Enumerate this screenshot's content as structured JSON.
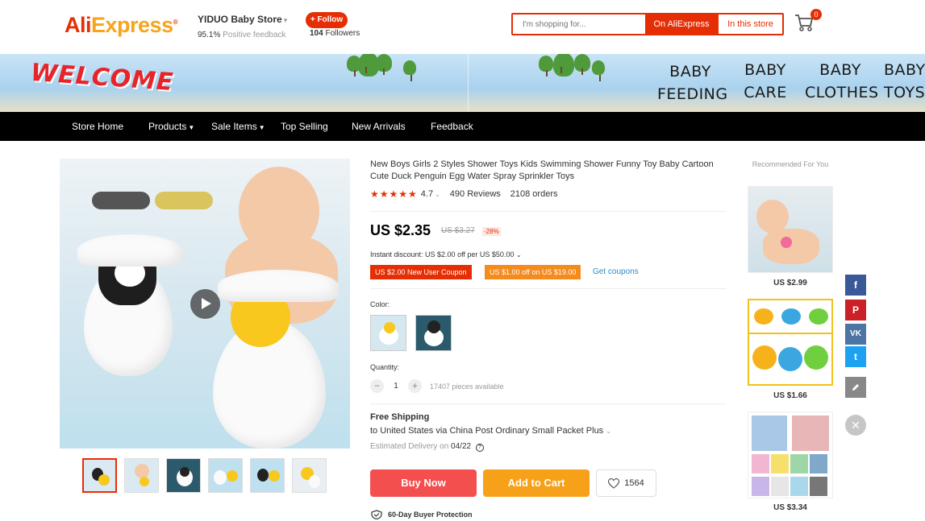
{
  "header": {
    "logo_main": "AliExpress",
    "logo_mark": "®",
    "store_name": "YIDUO Baby Store",
    "feedback_pct": "95.1%",
    "feedback_label": "Positive feedback",
    "follow_label": "+ Follow",
    "followers_count": "104",
    "followers_label": "Followers",
    "search_placeholder": "I'm shopping for...",
    "search_btn_ali": "On AliExpress",
    "search_btn_store": "In this store",
    "cart_count": "0"
  },
  "banner": {
    "welcome": "WELCOME",
    "categories": [
      {
        "line1": "BABY",
        "line2": "FEEDING"
      },
      {
        "line1": "BABY",
        "line2": "CARE"
      },
      {
        "line1": "BABY",
        "line2": "CLOTHES"
      },
      {
        "line1": "BABY",
        "line2": "TOYS"
      }
    ]
  },
  "nav": {
    "items": [
      "Store Home",
      "Products",
      "Sale Items",
      "Top Selling",
      "New Arrivals",
      "Feedback"
    ]
  },
  "product": {
    "title": "New Boys Girls 2 Styles Shower Toys Kids Swimming Shower Funny Toy Baby Cartoon Cute Duck Penguin Egg Water Spray Sprinkler Toys",
    "stars": "★★★★★",
    "rating": "4.7",
    "reviews": "490 Reviews",
    "orders": "2108 orders",
    "price": "US $2.35",
    "old_price": "US $3.27",
    "discount": "-28%",
    "instant_discount": "Instant discount: US $2.00 off per US $50.00",
    "coupon_1": "US $2.00 New User Coupon",
    "coupon_2": "US $1.00 off on US $19.00",
    "get_coupons": "Get coupons",
    "color_label": "Color:",
    "quantity_label": "Quantity:",
    "quantity_value": "1",
    "available": "17407 pieces available",
    "shipping_title": "Free Shipping",
    "shipping_to": "to United States via China Post Ordinary Small Packet Plus",
    "est_label": "Estimated Delivery on",
    "est_date": "04/22",
    "buy_now": "Buy Now",
    "add_to_cart": "Add to Cart",
    "wishlist_count": "1564",
    "protection": "60-Day Buyer Protection"
  },
  "recommended": {
    "title": "Recommended For You",
    "items": [
      {
        "price": "US $2.99"
      },
      {
        "price": "US $1.66"
      },
      {
        "price": "US $3.34"
      }
    ]
  },
  "social": {
    "facebook": "f",
    "pinterest": "P",
    "vk": "VK",
    "twitter": "t",
    "close": "✕"
  },
  "colors": {
    "brand_red": "#e62e04",
    "brand_orange": "#f7a11a",
    "facebook": "#3b5998",
    "pinterest": "#cb2027",
    "vk": "#4c75a3",
    "twitter": "#1da1f2",
    "edit": "#888888"
  }
}
